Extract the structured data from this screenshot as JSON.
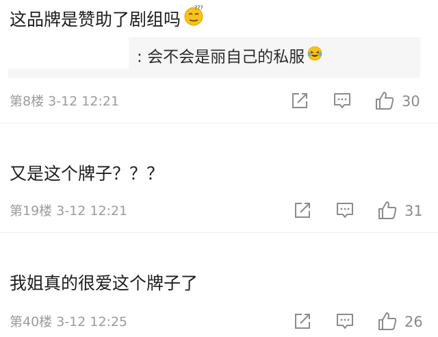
{
  "comments": [
    {
      "text": "这品牌是赞助了剧组吗",
      "emoji": "thinking-face",
      "reply_quote": {
        "prefix": ":",
        "text": "会不会是丽自己的私服",
        "emoji": "laughing-crying-face"
      },
      "floor": "第8楼",
      "time": "3-12 12:21",
      "likes": "30"
    },
    {
      "text": "又是这个牌子？？？",
      "floor": "第19楼",
      "time": "3-12 12:21",
      "likes": "31"
    },
    {
      "text": "我姐真的很爱这个牌子了",
      "floor": "第40楼",
      "time": "3-12 12:25",
      "likes": "26"
    }
  ],
  "icons": {
    "edit": "edit-icon",
    "comment": "comment-icon",
    "like": "thumbs-up-icon"
  },
  "colors": {
    "meta_text": "#9b9b9b",
    "icon": "#8a8a8a",
    "quote_bg": "#f6f6f6"
  }
}
